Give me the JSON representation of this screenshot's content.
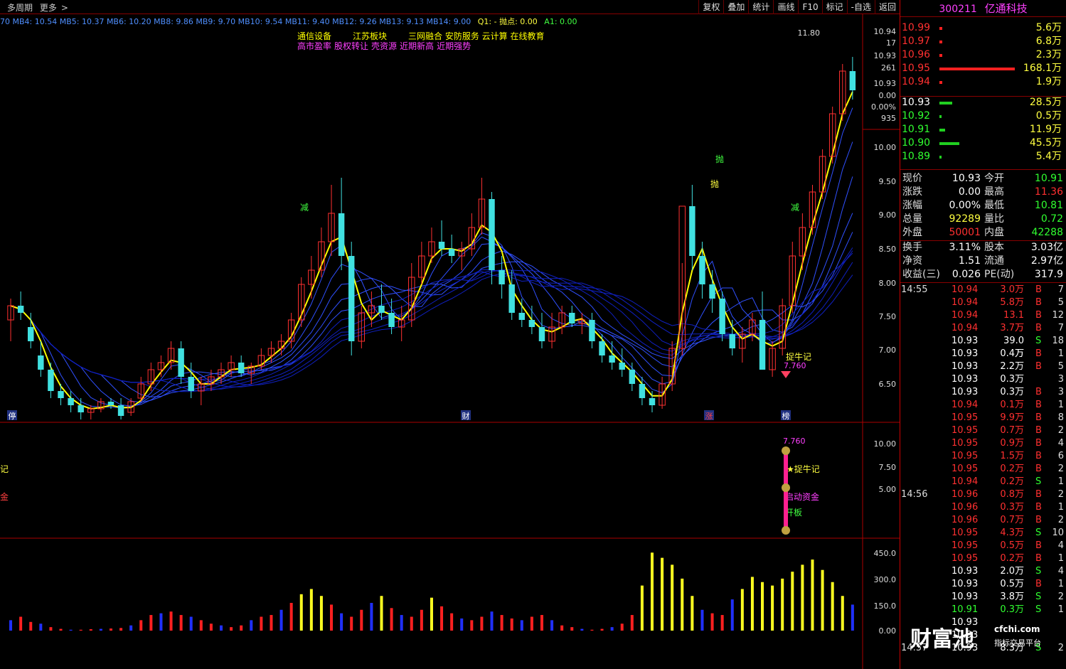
{
  "toolbar": {
    "period": "多周期",
    "more": "更多",
    "more_icon": "chevron-right-icon",
    "buttons": [
      "复权",
      "叠加",
      "统计",
      "画线",
      "F10",
      "标记",
      "-自选",
      "返回"
    ]
  },
  "mabar": {
    "ma": "70 MB4: 10.54 MB5: 10.37 MB6: 10.20 MB8: 9.86 MB9: 9.70 MB10: 9.54 MB11: 9.40 MB12: 9.26 MB13: 9.13 MB14: 9.00",
    "q1": "Q1: - 抛点: 0.00",
    "a1": "A1: 0.00"
  },
  "tags": {
    "row1": [
      "通信设备",
      "江苏板块",
      "三网融合 安防服务 云计算 在线教育"
    ],
    "row2": [
      "高市盈率",
      "股权转让",
      "壳资源",
      "近期新高",
      "近期强势"
    ]
  },
  "main_axis": {
    "labels": [
      "10.94",
      "17",
      "10.93",
      "261",
      "10.93",
      "0.00",
      "0.00%",
      "935",
      "10.00",
      "9.50",
      "9.00",
      "8.50",
      "8.00",
      "7.50",
      "7.00",
      "6.50"
    ],
    "high_mark": "11.80"
  },
  "mid_axis": {
    "labels": [
      "10.00",
      "7.50",
      "5.00"
    ]
  },
  "vol_axis": {
    "labels": [
      "450.0",
      "300.0",
      "150.0",
      "0.00"
    ]
  },
  "annotations": {
    "jian1": "减",
    "pao1": "抛",
    "pao2": "抛",
    "jian2": "减",
    "tiniu": "捉牛记",
    "low": "7.760",
    "mid_low": "7.760",
    "mid_tiniu": "★捉牛记",
    "mid_qd": "启动资金",
    "mid_kb": "开板",
    "left_ji": "记",
    "left_jin": "金",
    "bottom_markers": [
      "停",
      "财",
      "涨",
      "榜"
    ]
  },
  "ticker": {
    "code": "300211",
    "name": "亿通科技"
  },
  "asks": [
    {
      "p": "10.99",
      "v": "5.6万",
      "w": 4
    },
    {
      "p": "10.97",
      "v": "6.8万",
      "w": 4
    },
    {
      "p": "10.96",
      "v": "2.3万",
      "w": 4
    },
    {
      "p": "10.95",
      "v": "168.1万",
      "w": 106
    },
    {
      "p": "10.94",
      "v": "1.9万",
      "w": 4
    }
  ],
  "bids": [
    {
      "p": "10.93",
      "v": "28.5万",
      "w": 18,
      "c": "#fff"
    },
    {
      "p": "10.92",
      "v": "0.5万",
      "w": 3,
      "c": "#30ff30"
    },
    {
      "p": "10.91",
      "v": "11.9万",
      "w": 8,
      "c": "#30ff30"
    },
    {
      "p": "10.90",
      "v": "45.5万",
      "w": 28,
      "c": "#30ff30"
    },
    {
      "p": "10.89",
      "v": "5.4万",
      "w": 3,
      "c": "#30ff30"
    }
  ],
  "quote": [
    {
      "l1": "现价",
      "v1": "10.93",
      "c1": "#fff",
      "l2": "今开",
      "v2": "10.91",
      "c2": "#30ff30"
    },
    {
      "l1": "涨跌",
      "v1": "0.00",
      "c1": "#fff",
      "l2": "最高",
      "v2": "11.36",
      "c2": "#ff3030"
    },
    {
      "l1": "涨幅",
      "v1": "0.00%",
      "c1": "#fff",
      "l2": "最低",
      "v2": "10.81",
      "c2": "#30ff30"
    },
    {
      "l1": "总量",
      "v1": "92289",
      "c1": "#ffff40",
      "l2": "量比",
      "v2": "0.72",
      "c2": "#30ff30"
    },
    {
      "l1": "外盘",
      "v1": "50001",
      "c1": "#ff3030",
      "l2": "内盘",
      "v2": "42288",
      "c2": "#30ff30"
    }
  ],
  "fund": [
    {
      "l1": "换手",
      "v1": "3.11%",
      "l2": "股本",
      "v2": "3.03亿"
    },
    {
      "l1": "净资",
      "v1": "1.51",
      "l2": "流通",
      "v2": "2.97亿"
    },
    {
      "l1": "收益(三)",
      "v1": "0.026",
      "l2": "PE(动)",
      "v2": "317.9"
    }
  ],
  "ticks": [
    {
      "t": "14:55",
      "p": "10.94",
      "v": "3.0万",
      "bs": "B",
      "n": "7"
    },
    {
      "t": "",
      "p": "10.94",
      "v": "5.8万",
      "bs": "B",
      "n": "5"
    },
    {
      "t": "",
      "p": "10.94",
      "v": "13.1万",
      "bs": "B",
      "n": "12"
    },
    {
      "t": "",
      "p": "10.94",
      "v": "3.7万",
      "bs": "B",
      "n": "7"
    },
    {
      "t": "",
      "p": "10.93",
      "v": "39.0万",
      "bs": "S",
      "n": "18"
    },
    {
      "t": "",
      "p": "10.93",
      "v": "0.4万",
      "bs": "B",
      "n": "1"
    },
    {
      "t": "",
      "p": "10.93",
      "v": "2.2万",
      "bs": "B",
      "n": "5"
    },
    {
      "t": "",
      "p": "10.93",
      "v": "0.3万",
      "bs": "",
      "n": "3"
    },
    {
      "t": "",
      "p": "10.93",
      "v": "0.3万",
      "bs": "B",
      "n": "3"
    },
    {
      "t": "",
      "p": "10.94",
      "v": "0.1万",
      "bs": "B",
      "n": "1"
    },
    {
      "t": "",
      "p": "10.95",
      "v": "9.9万",
      "bs": "B",
      "n": "8"
    },
    {
      "t": "",
      "p": "10.95",
      "v": "0.7万",
      "bs": "B",
      "n": "2"
    },
    {
      "t": "",
      "p": "10.95",
      "v": "0.9万",
      "bs": "B",
      "n": "4"
    },
    {
      "t": "",
      "p": "10.95",
      "v": "1.5万",
      "bs": "B",
      "n": "6"
    },
    {
      "t": "",
      "p": "10.95",
      "v": "0.2万",
      "bs": "B",
      "n": "2"
    },
    {
      "t": "",
      "p": "10.94",
      "v": "0.2万",
      "bs": "S",
      "n": "1"
    },
    {
      "t": "14:56",
      "p": "10.96",
      "v": "0.8万",
      "bs": "B",
      "n": "2"
    },
    {
      "t": "",
      "p": "10.96",
      "v": "0.3万",
      "bs": "B",
      "n": "1"
    },
    {
      "t": "",
      "p": "10.96",
      "v": "0.7万",
      "bs": "B",
      "n": "2"
    },
    {
      "t": "",
      "p": "10.95",
      "v": "4.3万",
      "bs": "S",
      "n": "10"
    },
    {
      "t": "",
      "p": "10.95",
      "v": "0.5万",
      "bs": "B",
      "n": "4"
    },
    {
      "t": "",
      "p": "10.95",
      "v": "0.2万",
      "bs": "B",
      "n": "1"
    },
    {
      "t": "",
      "p": "10.93",
      "v": "2.0万",
      "bs": "S",
      "n": "4"
    },
    {
      "t": "",
      "p": "10.93",
      "v": "0.5万",
      "bs": "B",
      "n": "1"
    },
    {
      "t": "",
      "p": "10.93",
      "v": "3.8万",
      "bs": "S",
      "n": "2"
    },
    {
      "t": "",
      "p": "10.91",
      "v": "0.3万",
      "bs": "S",
      "n": "1"
    },
    {
      "t": "",
      "p": "10.93",
      "v": "",
      "bs": "",
      "n": ""
    },
    {
      "t": "",
      "p": "10.93",
      "v": "",
      "bs": "",
      "n": ""
    },
    {
      "t": "14:57",
      "p": "10.93",
      "v": "8.3万",
      "bs": "S",
      "n": "2"
    }
  ],
  "watermark": {
    "cn": "财富池",
    "en": "cfchi.com",
    "sub": "指标交易平台"
  },
  "chart_data": {
    "type": "candlestick",
    "ylim": [
      6.3,
      11.9
    ],
    "candles": [
      [
        7.7,
        8.0,
        7.4,
        7.9
      ],
      [
        7.9,
        8.1,
        7.7,
        7.8
      ],
      [
        7.6,
        7.8,
        7.3,
        7.4
      ],
      [
        7.2,
        7.4,
        6.9,
        7.0
      ],
      [
        7.0,
        7.1,
        6.6,
        6.7
      ],
      [
        6.7,
        6.8,
        6.5,
        6.6
      ],
      [
        6.6,
        6.7,
        6.4,
        6.5
      ],
      [
        6.5,
        6.6,
        6.3,
        6.4
      ],
      [
        6.4,
        6.5,
        6.3,
        6.45
      ],
      [
        6.45,
        6.6,
        6.4,
        6.55
      ],
      [
        6.55,
        6.6,
        6.45,
        6.5
      ],
      [
        6.5,
        6.6,
        6.3,
        6.35
      ],
      [
        6.4,
        6.6,
        6.35,
        6.55
      ],
      [
        6.6,
        6.9,
        6.55,
        6.8
      ],
      [
        6.8,
        7.1,
        6.7,
        7.0
      ],
      [
        7.0,
        7.2,
        6.9,
        7.1
      ],
      [
        7.1,
        7.4,
        7.0,
        7.3
      ],
      [
        7.3,
        7.4,
        6.8,
        6.9
      ],
      [
        6.9,
        7.1,
        6.6,
        6.7
      ],
      [
        6.7,
        6.9,
        6.5,
        6.8
      ],
      [
        6.8,
        7.0,
        6.7,
        6.9
      ],
      [
        6.9,
        7.1,
        6.8,
        7.0
      ],
      [
        7.0,
        7.2,
        6.9,
        7.1
      ],
      [
        7.1,
        7.2,
        6.9,
        6.95
      ],
      [
        6.95,
        7.1,
        6.8,
        7.05
      ],
      [
        7.05,
        7.3,
        7.0,
        7.2
      ],
      [
        7.2,
        7.4,
        7.1,
        7.3
      ],
      [
        7.3,
        7.5,
        7.2,
        7.4
      ],
      [
        7.4,
        7.8,
        7.3,
        7.7
      ],
      [
        7.7,
        8.3,
        7.6,
        8.2
      ],
      [
        8.2,
        8.6,
        8.0,
        8.4
      ],
      [
        8.4,
        9.0,
        8.3,
        8.8
      ],
      [
        8.8,
        9.6,
        8.6,
        9.2
      ],
      [
        9.2,
        9.7,
        8.4,
        8.6
      ],
      [
        8.6,
        8.8,
        7.2,
        7.4
      ],
      [
        7.4,
        7.9,
        7.3,
        7.8
      ],
      [
        7.8,
        8.1,
        7.6,
        7.9
      ],
      [
        7.9,
        8.2,
        7.7,
        7.8
      ],
      [
        7.8,
        8.0,
        7.5,
        7.6
      ],
      [
        7.6,
        7.9,
        7.4,
        7.7
      ],
      [
        7.7,
        8.5,
        7.6,
        8.3
      ],
      [
        8.3,
        8.8,
        8.2,
        8.6
      ],
      [
        8.6,
        9.0,
        8.5,
        8.8
      ],
      [
        8.8,
        9.1,
        8.6,
        8.7
      ],
      [
        8.7,
        8.9,
        8.5,
        8.6
      ],
      [
        8.6,
        8.8,
        8.4,
        8.7
      ],
      [
        8.7,
        9.2,
        8.6,
        9.0
      ],
      [
        9.0,
        9.7,
        8.9,
        9.4
      ],
      [
        9.4,
        9.5,
        8.2,
        8.4
      ],
      [
        8.4,
        8.6,
        8.0,
        8.2
      ],
      [
        8.2,
        8.4,
        7.7,
        7.8
      ],
      [
        7.8,
        8.0,
        7.6,
        7.7
      ],
      [
        7.7,
        7.9,
        7.5,
        7.6
      ],
      [
        7.6,
        7.8,
        7.3,
        7.4
      ],
      [
        7.4,
        7.8,
        7.3,
        7.6
      ],
      [
        7.6,
        7.9,
        7.5,
        7.8
      ],
      [
        7.8,
        7.9,
        7.6,
        7.65
      ],
      [
        7.65,
        7.8,
        7.5,
        7.7
      ],
      [
        7.7,
        7.8,
        7.3,
        7.4
      ],
      [
        7.4,
        7.5,
        7.1,
        7.2
      ],
      [
        7.2,
        7.4,
        7.0,
        7.1
      ],
      [
        7.1,
        7.3,
        6.9,
        7.0
      ],
      [
        7.0,
        7.1,
        6.7,
        6.8
      ],
      [
        6.8,
        6.9,
        6.5,
        6.6
      ],
      [
        6.6,
        6.7,
        6.4,
        6.5
      ],
      [
        6.5,
        6.9,
        6.45,
        6.8
      ],
      [
        6.8,
        7.4,
        6.7,
        7.3
      ],
      [
        7.3,
        8.5,
        7.2,
        9.3
      ],
      [
        9.3,
        9.6,
        8.4,
        8.6
      ],
      [
        8.6,
        8.8,
        8.0,
        8.2
      ],
      [
        8.2,
        8.4,
        7.8,
        8.0
      ],
      [
        8.0,
        8.1,
        7.4,
        7.5
      ],
      [
        7.5,
        7.7,
        7.2,
        7.3
      ],
      [
        7.3,
        7.6,
        7.1,
        7.5
      ],
      [
        7.5,
        7.8,
        7.4,
        7.7
      ],
      [
        7.7,
        8.1,
        7.6,
        7.0
      ],
      [
        7.0,
        7.4,
        6.9,
        7.3
      ],
      [
        7.3,
        8.0,
        7.2,
        7.9
      ],
      [
        7.9,
        8.8,
        7.8,
        8.6
      ],
      [
        8.6,
        9.2,
        8.4,
        9.0
      ],
      [
        9.0,
        9.6,
        8.9,
        9.5
      ],
      [
        9.5,
        10.1,
        9.4,
        10.0
      ],
      [
        10.0,
        10.7,
        9.9,
        10.6
      ],
      [
        10.6,
        11.3,
        10.5,
        11.2
      ],
      [
        11.2,
        11.4,
        10.8,
        10.93
      ]
    ],
    "volume": [
      60,
      80,
      50,
      40,
      20,
      10,
      5,
      5,
      8,
      10,
      12,
      15,
      30,
      60,
      90,
      100,
      110,
      90,
      80,
      60,
      40,
      30,
      20,
      30,
      60,
      80,
      90,
      120,
      160,
      210,
      240,
      200,
      150,
      100,
      80,
      120,
      160,
      200,
      130,
      90,
      80,
      120,
      190,
      140,
      100,
      70,
      60,
      80,
      110,
      90,
      70,
      60,
      80,
      90,
      60,
      30,
      20,
      10,
      5,
      10,
      20,
      40,
      90,
      260,
      450,
      420,
      380,
      300,
      200,
      120,
      100,
      90,
      180,
      240,
      310,
      280,
      260,
      300,
      340,
      380,
      410,
      350,
      280,
      200,
      150
    ],
    "vol_ylim": [
      0,
      480
    ]
  }
}
